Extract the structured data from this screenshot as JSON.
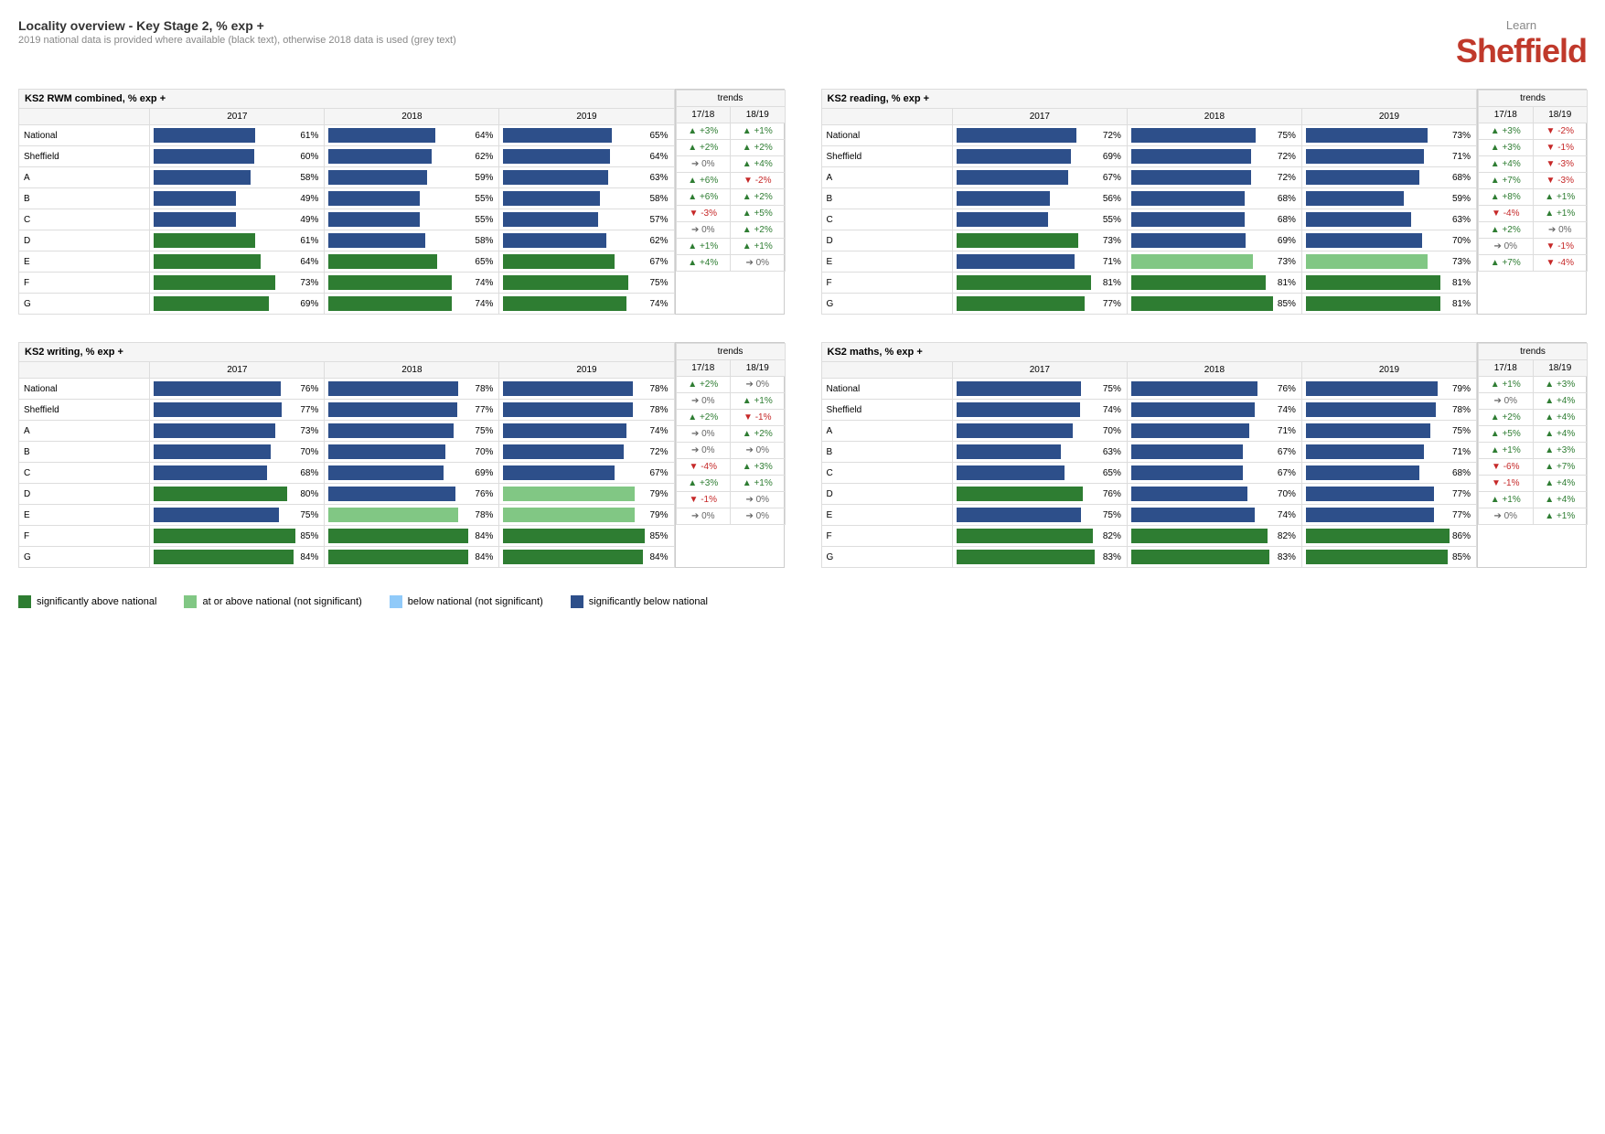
{
  "header": {
    "title": "Locality overview - Key Stage 2, % exp +",
    "subtitle": "2019 national data is provided where available (black text), otherwise 2018 data is used (grey text)"
  },
  "logo": {
    "learn": "Learn",
    "name": "Sheffield"
  },
  "legend": {
    "items": [
      {
        "color": "#2e7d32",
        "label": "significantly above national"
      },
      {
        "color": "#81c784",
        "label": "at or above national (not significant)"
      },
      {
        "color": "#90caf9",
        "label": "below national (not significant)"
      },
      {
        "color": "#2d4f8a",
        "label": "significantly below national"
      }
    ]
  },
  "charts": [
    {
      "title": "KS2 RWM combined, % exp +",
      "rows": [
        {
          "label": "National",
          "y2017": 61,
          "y2018": 64,
          "y2019": 65,
          "t1718": "+3%",
          "t1819": "+1%",
          "t1718dir": "up",
          "t1819dir": "up",
          "c17": "dark",
          "c18": "dark",
          "c19": "dark"
        },
        {
          "label": "Sheffield",
          "y2017": 60,
          "y2018": 62,
          "y2019": 64,
          "t1718": "+2%",
          "t1819": "+2%",
          "t1718dir": "up",
          "t1819dir": "up",
          "c17": "dark",
          "c18": "dark",
          "c19": "dark"
        },
        {
          "label": "A",
          "y2017": 58,
          "y2018": 59,
          "y2019": 63,
          "t1718": "0%",
          "t1819": "+4%",
          "t1718dir": "flat",
          "t1819dir": "up",
          "c17": "dark",
          "c18": "dark",
          "c19": "dark"
        },
        {
          "label": "B",
          "y2017": 49,
          "y2018": 55,
          "y2019": 58,
          "t1718": "+6%",
          "t1819": "-2%",
          "t1718dir": "up",
          "t1819dir": "down",
          "c17": "dark",
          "c18": "dark",
          "c19": "dark"
        },
        {
          "label": "C",
          "y2017": 49,
          "y2018": 55,
          "y2019": 57,
          "t1718": "+6%",
          "t1819": "+2%",
          "t1718dir": "up",
          "t1819dir": "up",
          "c17": "dark",
          "c18": "dark",
          "c19": "dark"
        },
        {
          "label": "D",
          "y2017": 61,
          "y2018": 58,
          "y2019": 62,
          "t1718": "-3%",
          "t1819": "+5%",
          "t1718dir": "down",
          "t1819dir": "up",
          "c17": "green-sig",
          "c18": "dark",
          "c19": "dark"
        },
        {
          "label": "E",
          "y2017": 64,
          "y2018": 65,
          "y2019": 67,
          "t1718": "0%",
          "t1819": "+2%",
          "t1718dir": "flat",
          "t1819dir": "up",
          "c17": "green-sig",
          "c18": "green-sig",
          "c19": "green-sig"
        },
        {
          "label": "F",
          "y2017": 73,
          "y2018": 74,
          "y2019": 75,
          "t1718": "+1%",
          "t1819": "+1%",
          "t1718dir": "up",
          "t1819dir": "up",
          "c17": "green-sig",
          "c18": "green-sig",
          "c19": "green-sig"
        },
        {
          "label": "G",
          "y2017": 69,
          "y2018": 74,
          "y2019": 74,
          "t1718": "+4%",
          "t1819": "0%",
          "t1718dir": "up",
          "t1819dir": "flat",
          "c17": "green-sig",
          "c18": "green-sig",
          "c19": "green-sig"
        }
      ]
    },
    {
      "title": "KS2 reading, % exp +",
      "rows": [
        {
          "label": "National",
          "y2017": 72,
          "y2018": 75,
          "y2019": 73,
          "t1718": "+3%",
          "t1819": "-2%",
          "t1718dir": "up",
          "t1819dir": "down",
          "c17": "dark",
          "c18": "dark",
          "c19": "dark"
        },
        {
          "label": "Sheffield",
          "y2017": 69,
          "y2018": 72,
          "y2019": 71,
          "t1718": "+3%",
          "t1819": "-1%",
          "t1718dir": "up",
          "t1819dir": "down",
          "c17": "dark",
          "c18": "dark",
          "c19": "dark"
        },
        {
          "label": "A",
          "y2017": 67,
          "y2018": 72,
          "y2019": 68,
          "t1718": "+4%",
          "t1819": "-3%",
          "t1718dir": "up",
          "t1819dir": "down",
          "c17": "dark",
          "c18": "dark",
          "c19": "dark"
        },
        {
          "label": "B",
          "y2017": 56,
          "y2018": 68,
          "y2019": 59,
          "t1718": "+7%",
          "t1819": "-3%",
          "t1718dir": "up",
          "t1819dir": "down",
          "c17": "dark",
          "c18": "dark",
          "c19": "dark"
        },
        {
          "label": "C",
          "y2017": 55,
          "y2018": 68,
          "y2019": 63,
          "t1718": "+8%",
          "t1819": "+1%",
          "t1718dir": "up",
          "t1819dir": "up",
          "c17": "dark",
          "c18": "dark",
          "c19": "dark"
        },
        {
          "label": "D",
          "y2017": 73,
          "y2018": 69,
          "y2019": 70,
          "t1718": "-4%",
          "t1819": "+1%",
          "t1718dir": "down",
          "t1819dir": "up",
          "c17": "green-sig",
          "c18": "dark",
          "c19": "dark"
        },
        {
          "label": "E",
          "y2017": 71,
          "y2018": 73,
          "y2019": 73,
          "t1718": "+2%",
          "t1819": "0%",
          "t1718dir": "up",
          "t1819dir": "flat",
          "c17": "dark",
          "c18": "green-not",
          "c19": "green-not"
        },
        {
          "label": "F",
          "y2017": 81,
          "y2018": 81,
          "y2019": 81,
          "t1718": "0%",
          "t1819": "-1%",
          "t1718dir": "flat",
          "t1819dir": "down",
          "c17": "green-sig",
          "c18": "green-sig",
          "c19": "green-sig"
        },
        {
          "label": "G",
          "y2017": 77,
          "y2018": 85,
          "y2019": 81,
          "t1718": "+7%",
          "t1819": "-4%",
          "t1718dir": "up",
          "t1819dir": "down",
          "c17": "green-sig",
          "c18": "green-sig",
          "c19": "green-sig"
        }
      ]
    },
    {
      "title": "KS2 writing, % exp +",
      "rows": [
        {
          "label": "National",
          "y2017": 76,
          "y2018": 78,
          "y2019": 78,
          "t1718": "+2%",
          "t1819": "0%",
          "t1718dir": "up",
          "t1819dir": "flat",
          "c17": "dark",
          "c18": "dark",
          "c19": "dark"
        },
        {
          "label": "Sheffield",
          "y2017": 77,
          "y2018": 77,
          "y2019": 78,
          "t1718": "0%",
          "t1819": "+1%",
          "t1718dir": "flat",
          "t1819dir": "up",
          "c17": "dark",
          "c18": "dark",
          "c19": "dark"
        },
        {
          "label": "A",
          "y2017": 73,
          "y2018": 75,
          "y2019": 74,
          "t1718": "+2%",
          "t1819": "-1%",
          "t1718dir": "up",
          "t1819dir": "down",
          "c17": "dark",
          "c18": "dark",
          "c19": "dark"
        },
        {
          "label": "B",
          "y2017": 70,
          "y2018": 70,
          "y2019": 72,
          "t1718": "0%",
          "t1819": "+2%",
          "t1718dir": "flat",
          "t1819dir": "up",
          "c17": "dark",
          "c18": "dark",
          "c19": "dark"
        },
        {
          "label": "C",
          "y2017": 68,
          "y2018": 69,
          "y2019": 67,
          "t1718": "0%",
          "t1819": "0%",
          "t1718dir": "flat",
          "t1819dir": "flat",
          "c17": "dark",
          "c18": "dark",
          "c19": "dark"
        },
        {
          "label": "D",
          "y2017": 80,
          "y2018": 76,
          "y2019": 79,
          "t1718": "-4%",
          "t1819": "+3%",
          "t1718dir": "down",
          "t1819dir": "up",
          "c17": "green-sig",
          "c18": "dark",
          "c19": "green-not"
        },
        {
          "label": "E",
          "y2017": 75,
          "y2018": 78,
          "y2019": 79,
          "t1718": "+3%",
          "t1819": "+1%",
          "t1718dir": "up",
          "t1819dir": "up",
          "c17": "dark",
          "c18": "green-not",
          "c19": "green-not"
        },
        {
          "label": "F",
          "y2017": 85,
          "y2018": 84,
          "y2019": 85,
          "t1718": "-1%",
          "t1819": "0%",
          "t1718dir": "down",
          "t1819dir": "flat",
          "c17": "green-sig",
          "c18": "green-sig",
          "c19": "green-sig"
        },
        {
          "label": "G",
          "y2017": 84,
          "y2018": 84,
          "y2019": 84,
          "t1718": "0%",
          "t1819": "0%",
          "t1718dir": "flat",
          "t1819dir": "flat",
          "c17": "green-sig",
          "c18": "green-sig",
          "c19": "green-sig"
        }
      ]
    },
    {
      "title": "KS2 maths, % exp +",
      "rows": [
        {
          "label": "National",
          "y2017": 75,
          "y2018": 76,
          "y2019": 79,
          "t1718": "+1%",
          "t1819": "+3%",
          "t1718dir": "up",
          "t1819dir": "up",
          "c17": "dark",
          "c18": "dark",
          "c19": "dark"
        },
        {
          "label": "Sheffield",
          "y2017": 74,
          "y2018": 74,
          "y2019": 78,
          "t1718": "0%",
          "t1819": "+4%",
          "t1718dir": "flat",
          "t1819dir": "up",
          "c17": "dark",
          "c18": "dark",
          "c19": "dark"
        },
        {
          "label": "A",
          "y2017": 70,
          "y2018": 71,
          "y2019": 75,
          "t1718": "+2%",
          "t1819": "+4%",
          "t1718dir": "up",
          "t1819dir": "up",
          "c17": "dark",
          "c18": "dark",
          "c19": "dark"
        },
        {
          "label": "B",
          "y2017": 63,
          "y2018": 67,
          "y2019": 71,
          "t1718": "+5%",
          "t1819": "+4%",
          "t1718dir": "up",
          "t1819dir": "up",
          "c17": "dark",
          "c18": "dark",
          "c19": "dark"
        },
        {
          "label": "C",
          "y2017": 65,
          "y2018": 67,
          "y2019": 68,
          "t1718": "+1%",
          "t1819": "+3%",
          "t1718dir": "up",
          "t1819dir": "up",
          "c17": "dark",
          "c18": "dark",
          "c19": "dark"
        },
        {
          "label": "D",
          "y2017": 76,
          "y2018": 70,
          "y2019": 77,
          "t1718": "-6%",
          "t1819": "+7%",
          "t1718dir": "down",
          "t1819dir": "up",
          "c17": "green-sig",
          "c18": "dark",
          "c19": "dark"
        },
        {
          "label": "E",
          "y2017": 75,
          "y2018": 74,
          "y2019": 77,
          "t1718": "-1%",
          "t1819": "+4%",
          "t1718dir": "down",
          "t1819dir": "up",
          "c17": "dark",
          "c18": "dark",
          "c19": "dark"
        },
        {
          "label": "F",
          "y2017": 82,
          "y2018": 82,
          "y2019": 86,
          "t1718": "+1%",
          "t1819": "+4%",
          "t1718dir": "up",
          "t1819dir": "up",
          "c17": "green-sig",
          "c18": "green-sig",
          "c19": "green-sig"
        },
        {
          "label": "G",
          "y2017": 83,
          "y2018": 83,
          "y2019": 85,
          "t1718": "0%",
          "t1819": "+1%",
          "t1718dir": "flat",
          "t1819dir": "up",
          "c17": "green-sig",
          "c18": "green-sig",
          "c19": "green-sig"
        }
      ]
    }
  ]
}
